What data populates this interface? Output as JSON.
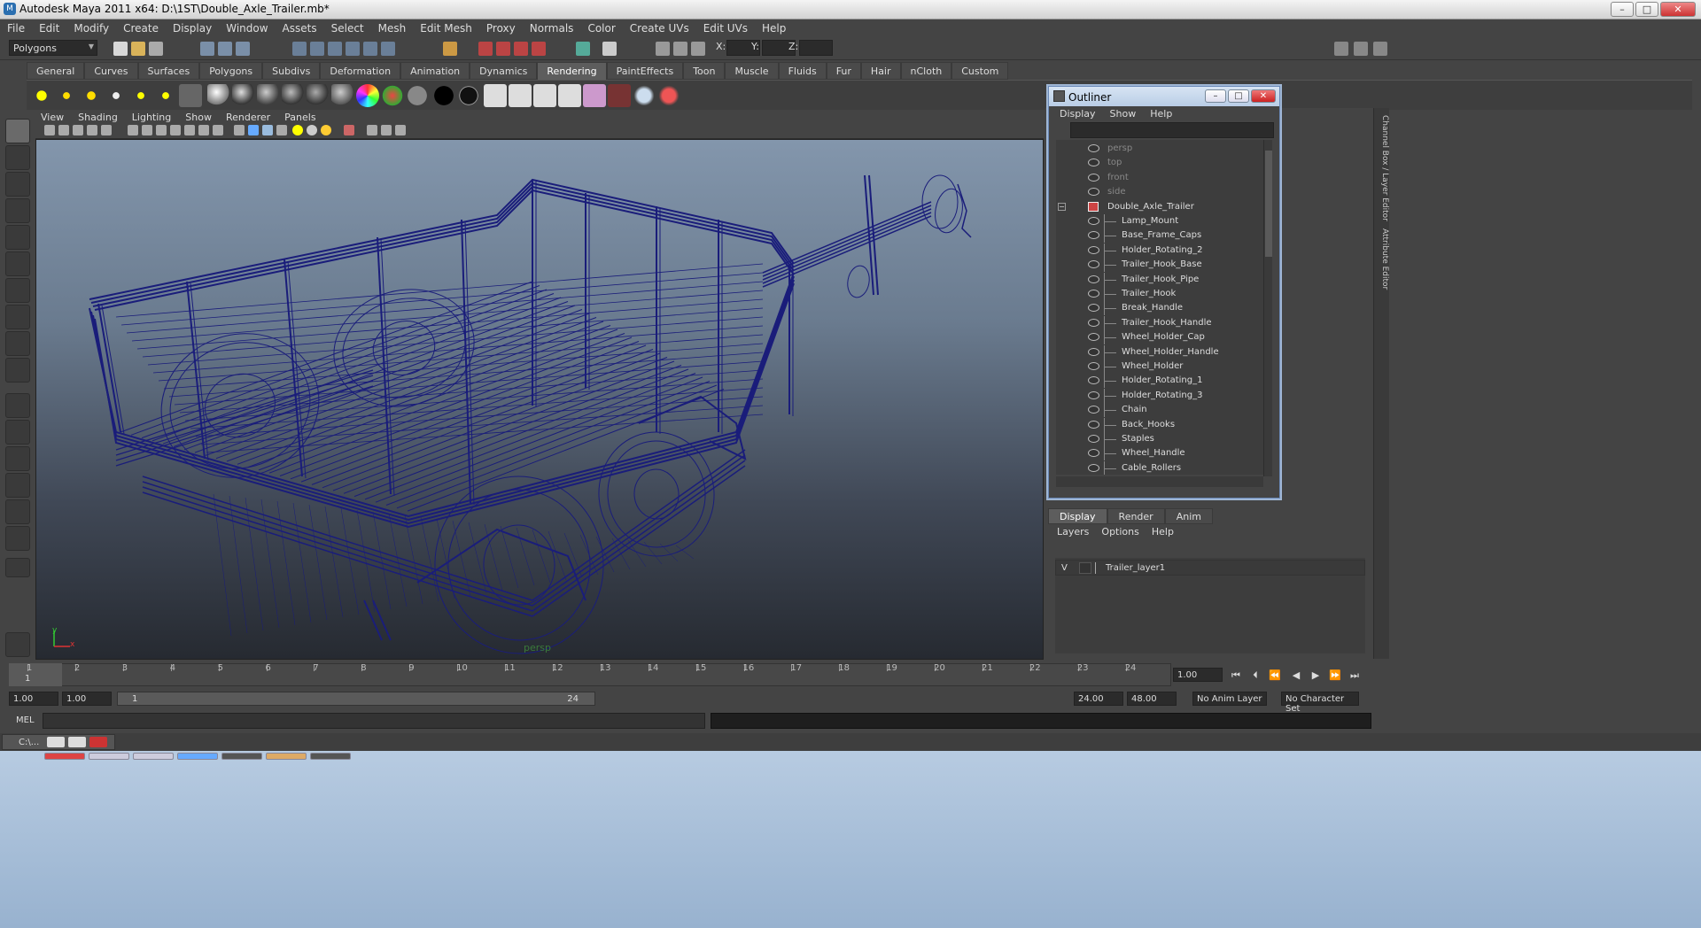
{
  "window": {
    "title": "Autodesk Maya 2011 x64: D:\\1ST\\Double_Axle_Trailer.mb*"
  },
  "menubar": [
    "File",
    "Edit",
    "Modify",
    "Create",
    "Display",
    "Window",
    "Assets",
    "Select",
    "Mesh",
    "Edit Mesh",
    "Proxy",
    "Normals",
    "Color",
    "Create UVs",
    "Edit UVs",
    "Help"
  ],
  "toolbar": {
    "mode": "Polygons",
    "x_label": "X:",
    "y_label": "Y:",
    "z_label": "Z:"
  },
  "shelf_tabs": [
    "General",
    "Curves",
    "Surfaces",
    "Polygons",
    "Subdivs",
    "Deformation",
    "Animation",
    "Dynamics",
    "Rendering",
    "PaintEffects",
    "Toon",
    "Muscle",
    "Fluids",
    "Fur",
    "Hair",
    "nCloth",
    "Custom"
  ],
  "shelf_active": "Rendering",
  "viewport": {
    "menu": [
      "View",
      "Shading",
      "Lighting",
      "Show",
      "Renderer",
      "Panels"
    ],
    "camera_label": "persp",
    "axis_y": "y",
    "axis_x": "x"
  },
  "outliner": {
    "title": "Outliner",
    "menu": [
      "Display",
      "Show",
      "Help"
    ],
    "cameras": [
      "persp",
      "top",
      "front",
      "side"
    ],
    "root": "Double_Axle_Trailer",
    "children": [
      "Lamp_Mount",
      "Base_Frame_Caps",
      "Holder_Rotating_2",
      "Trailer_Hook_Base",
      "Trailer_Hook_Pipe",
      "Trailer_Hook",
      "Break_Handle",
      "Trailer_Hook_Handle",
      "Wheel_Holder_Cap",
      "Wheel_Holder_Handle",
      "Wheel_Holder",
      "Holder_Rotating_1",
      "Holder_Rotating_3",
      "Chain",
      "Back_Hooks",
      "Staples",
      "Wheel_Handle",
      "Cable_Rollers"
    ]
  },
  "side_tabs": {
    "channel": "Channel Box / Layer Editor",
    "attribute": "Attribute Editor"
  },
  "layers": {
    "tabs": [
      "Display",
      "Render",
      "Anim"
    ],
    "menu": [
      "Layers",
      "Options",
      "Help"
    ],
    "visible_flag": "V",
    "layer_name": "Trailer_layer1"
  },
  "timeline": {
    "ticks": [
      "1",
      "2",
      "3",
      "4",
      "5",
      "6",
      "7",
      "8",
      "9",
      "10",
      "11",
      "12",
      "13",
      "14",
      "15",
      "16",
      "17",
      "18",
      "19",
      "20",
      "21",
      "22",
      "23",
      "24"
    ],
    "current": "1",
    "current_frame_field": "1.00"
  },
  "range": {
    "start": "1.00",
    "playback_start": "1.00",
    "bar_start": "1",
    "bar_end": "24",
    "playback_end": "24.00",
    "end": "48.00",
    "anim_layer": "No Anim Layer",
    "character_set": "No Character Set"
  },
  "command": {
    "label": "MEL"
  },
  "minimized": {
    "label": "C:\\..."
  }
}
